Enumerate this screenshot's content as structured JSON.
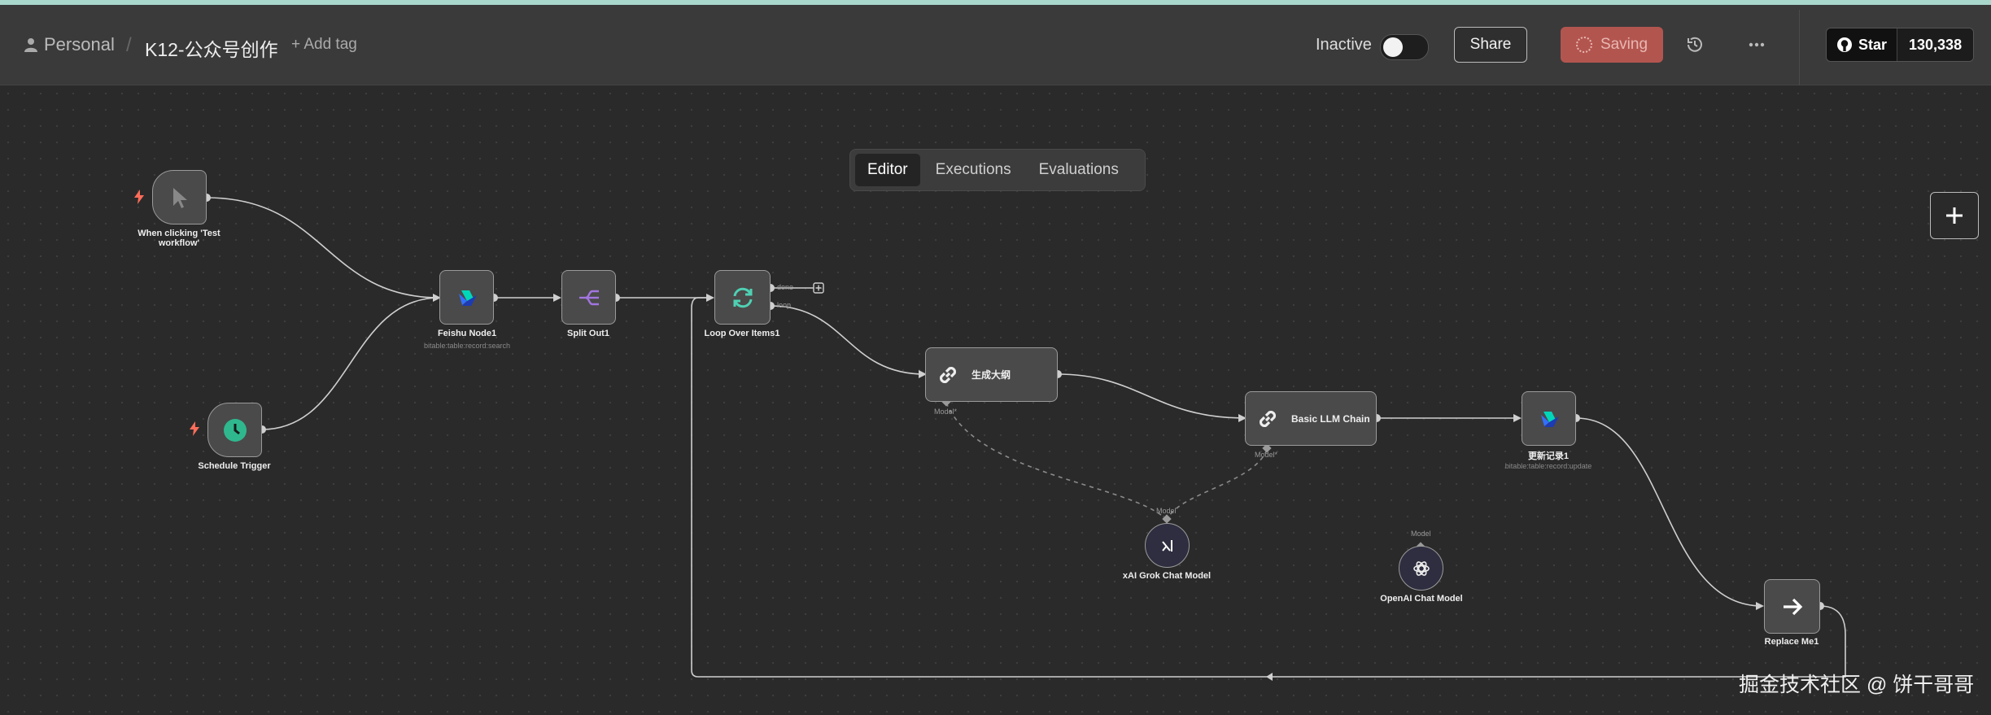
{
  "header": {
    "breadcrumb_personal": "Personal",
    "breadcrumb_sep": "/",
    "workflow_title": "K12-公众号创作",
    "add_tag": "+ Add tag",
    "status_label": "Inactive",
    "share_label": "Share",
    "saving_label": "Saving",
    "github_star_label": "Star",
    "github_star_count": "130,338"
  },
  "tabs": [
    {
      "label": "Editor",
      "active": true
    },
    {
      "label": "Executions",
      "active": false
    },
    {
      "label": "Evaluations",
      "active": false
    }
  ],
  "nodes": {
    "manual_trigger": {
      "label": "When clicking 'Test workflow'",
      "icon": "cursor-icon"
    },
    "schedule_trigger": {
      "label": "Schedule Trigger",
      "icon": "clock-icon"
    },
    "feishu": {
      "label": "Feishu Node1",
      "sub": "bitable:table:record:search",
      "icon": "feishu-icon"
    },
    "split_out": {
      "label": "Split Out1",
      "icon": "split-icon"
    },
    "loop": {
      "label": "Loop Over Items1",
      "done": "done",
      "loop": "loop",
      "icon": "loop-icon"
    },
    "outline": {
      "label": "生成大纲",
      "port": "Model*",
      "icon": "link-icon"
    },
    "llm_chain": {
      "label": "Basic LLM Chain",
      "port": "Model*",
      "icon": "link-icon"
    },
    "update": {
      "label": "更新记录1",
      "sub": "bitable:table:record:update",
      "icon": "feishu-icon"
    },
    "xai": {
      "label": "xAI Grok Chat Model",
      "port": "Model",
      "icon": "xai-icon"
    },
    "openai": {
      "label": "OpenAI Chat Model",
      "port": "Model",
      "icon": "openai-icon"
    },
    "replace": {
      "label": "Replace Me1",
      "icon": "arrow-right-icon"
    }
  },
  "watermark": "掘金技术社区 @ 饼干哥哥",
  "colors": {
    "trigger_bolt": "#ff6d5a",
    "schedule": "#2fb88e",
    "split": "#a275e0",
    "loop": "#4fd0b3",
    "saving": "#b3554f"
  }
}
